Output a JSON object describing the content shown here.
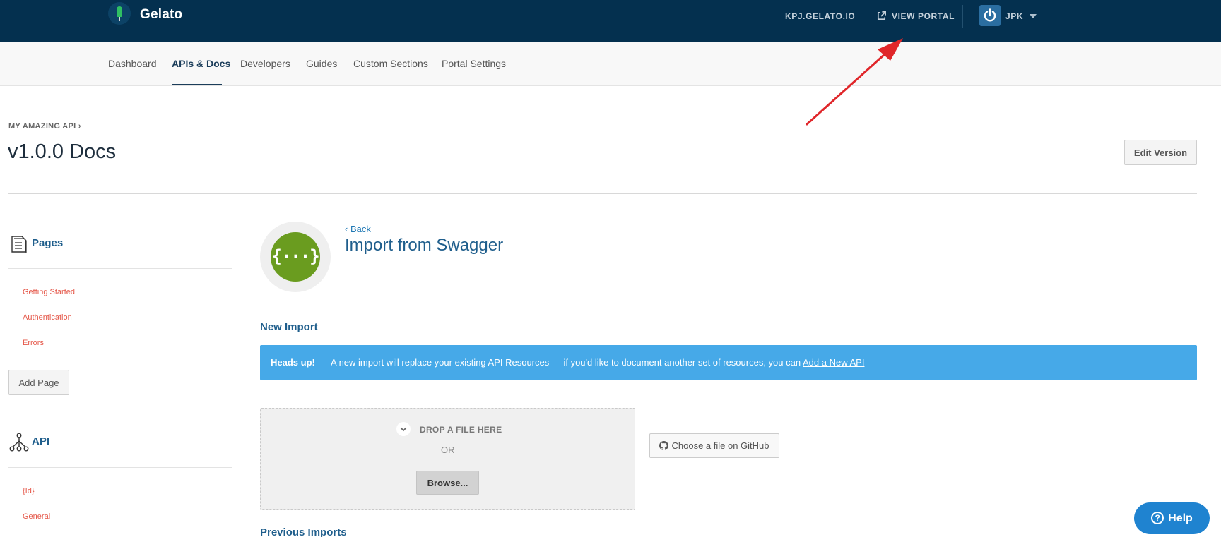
{
  "topbar": {
    "brand": "Gelato",
    "domain_link": "KPJ.GELATO.IO",
    "view_portal": "VIEW PORTAL",
    "user": "JPK",
    "colors": {
      "background": "#04304f",
      "accent": "#2fbf63"
    }
  },
  "subnav": {
    "items": [
      "Dashboard",
      "APIs & Docs",
      "Developers",
      "Guides",
      "Custom Sections",
      "Portal Settings"
    ],
    "active": "APIs & Docs"
  },
  "header": {
    "breadcrumb": "MY AMAZING API ›",
    "title": "v1.0.0 Docs",
    "edit_button": "Edit Version"
  },
  "sidebar": {
    "pages_heading": "Pages",
    "pages": [
      "Getting Started",
      "Authentication",
      "Errors"
    ],
    "add_page": "Add Page",
    "api_heading": "API",
    "api_items": [
      "{Id}",
      "General"
    ]
  },
  "main": {
    "logo_glyph": "{···}",
    "back": "‹ Back",
    "title": "Import from Swagger",
    "new_import": "New Import",
    "alert_strong": "Heads up!",
    "alert_text": "A new import will replace your existing API Resources — if you'd like to document another set of resources, you can",
    "alert_link": "Add a New API",
    "drop_label": "DROP A FILE HERE",
    "or": "OR",
    "browse": "Browse...",
    "github": "Choose a file on GitHub",
    "previous_imports": "Previous Imports"
  },
  "help": {
    "label": "Help"
  }
}
